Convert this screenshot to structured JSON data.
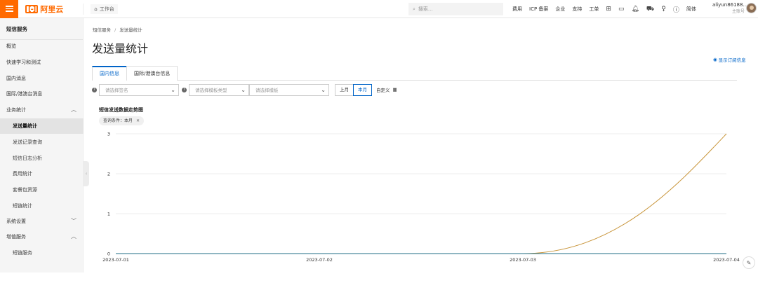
{
  "topbar": {
    "logo_text": "阿里云",
    "logo_mark": "[-]",
    "workbench": "工作台",
    "search_placeholder": "搜索...",
    "nav": [
      "费用",
      "ICP 备案",
      "企业",
      "支持",
      "工单"
    ],
    "lang": "简体",
    "user_name": "aliyun86188...",
    "user_role": "主账号",
    "brand_color": "#ff6a00"
  },
  "sidebar": {
    "title": "短信服务",
    "items": [
      {
        "label": "概览",
        "level": 0
      },
      {
        "label": "快速学习和测试",
        "level": 0
      },
      {
        "label": "国内消息",
        "level": 0
      },
      {
        "label": "国际/港澳台消息",
        "level": 0
      },
      {
        "label": "业务统计",
        "level": 0,
        "expanded": true
      },
      {
        "label": "发送量统计",
        "level": 1,
        "active": true
      },
      {
        "label": "发送记录查询",
        "level": 1
      },
      {
        "label": "短信日志分析",
        "level": 1
      },
      {
        "label": "费用统计",
        "level": 1
      },
      {
        "label": "套餐包资源",
        "level": 1
      },
      {
        "label": "短链统计",
        "level": 1
      },
      {
        "label": "系统设置",
        "level": 0,
        "expanded": false
      },
      {
        "label": "增值服务",
        "level": 0,
        "expanded": true
      },
      {
        "label": "短链服务",
        "level": 1
      }
    ]
  },
  "main": {
    "breadcrumb": [
      "短信服务",
      "发送量统计"
    ],
    "title": "发送量统计",
    "show_subscription": "显示订阅信息",
    "tabs": [
      {
        "label": "国内信息",
        "active": true
      },
      {
        "label": "国际/港澳台信息",
        "active": false
      }
    ],
    "filters": {
      "sign_placeholder": "请选择签名",
      "template_type_placeholder": "请选择模板类型",
      "template_placeholder": "请选择模板",
      "periods": [
        {
          "label": "上月",
          "active": false
        },
        {
          "label": "本月",
          "active": true
        }
      ],
      "custom": "自定义"
    },
    "chart_title": "短信发送数据走势图",
    "condition": "查询条件：本月",
    "accent_color": "#0064c8"
  },
  "chart_data": {
    "type": "line",
    "title": "短信发送数据走势图",
    "xlabel": "",
    "ylabel": "",
    "x": [
      "2023-07-01",
      "2023-07-02",
      "2023-07-03",
      "2023-07-04"
    ],
    "ylim": [
      0,
      3
    ],
    "yticks": [
      0,
      1,
      2,
      3
    ],
    "grid": true,
    "series": [
      {
        "values": [
          0,
          0,
          0,
          3
        ],
        "color": "#c8953a",
        "smooth": true
      },
      {
        "values": [
          0,
          0,
          0,
          0
        ],
        "color": "#1f6e84",
        "smooth": false
      }
    ]
  }
}
